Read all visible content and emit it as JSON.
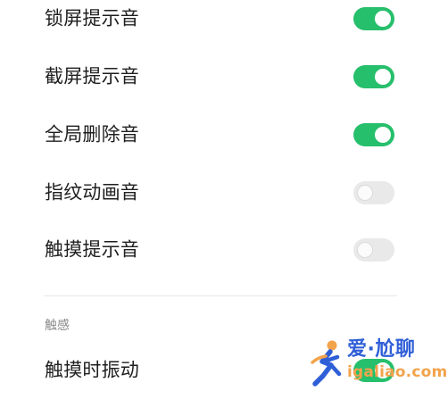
{
  "settings": {
    "items": [
      {
        "label": "锁屏提示音",
        "enabled": true
      },
      {
        "label": "截屏提示音",
        "enabled": true
      },
      {
        "label": "全局删除音",
        "enabled": true
      },
      {
        "label": "指纹动画音",
        "enabled": false
      },
      {
        "label": "触摸提示音",
        "enabled": false
      }
    ],
    "section_title": "触感",
    "vibration": {
      "label": "触摸时振动",
      "enabled": true
    }
  },
  "watermark": {
    "title": "爱·尬聊",
    "url": "igaliao.com"
  },
  "colors": {
    "toggle_on": "#26bf6c",
    "toggle_off": "#e9e9e9",
    "watermark_blue": "#2f5fd7",
    "watermark_orange": "#f2a34b"
  }
}
